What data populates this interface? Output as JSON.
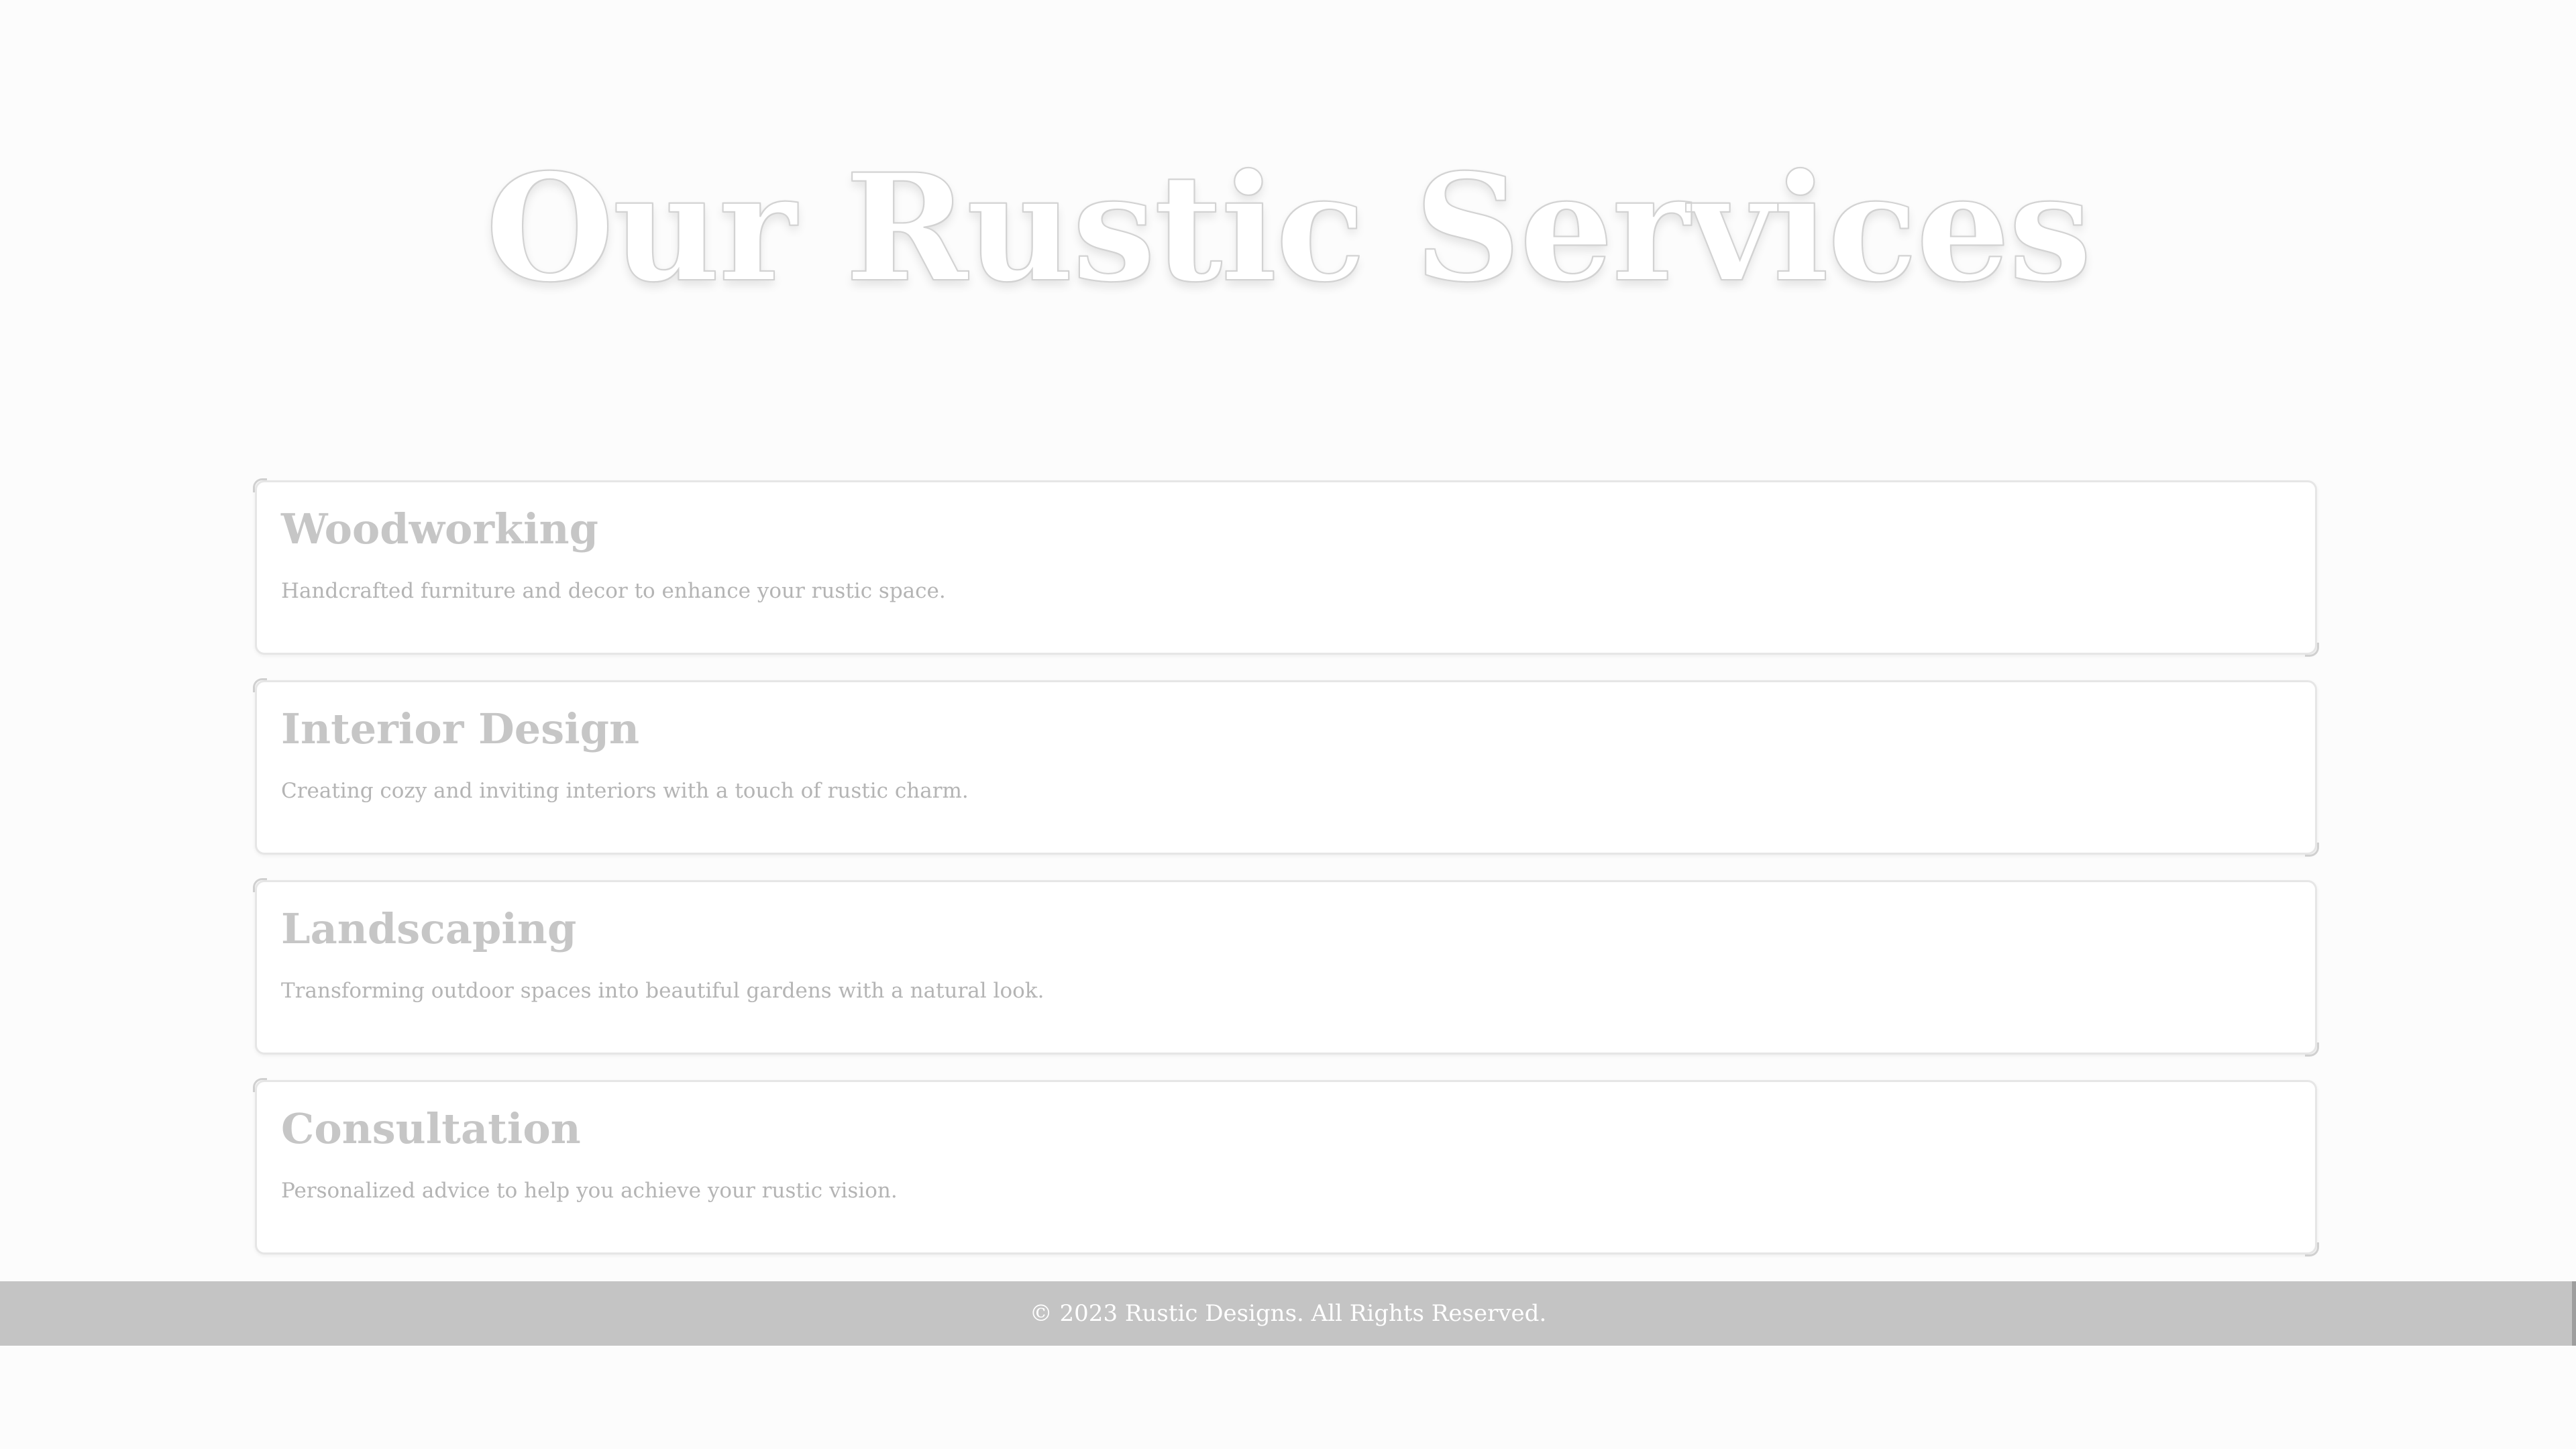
{
  "hero": {
    "title": "Our Rustic Services"
  },
  "services": [
    {
      "title": "Woodworking",
      "description": "Handcrafted furniture and decor to enhance your rustic space."
    },
    {
      "title": "Interior Design",
      "description": "Creating cozy and inviting interiors with a touch of rustic charm."
    },
    {
      "title": "Landscaping",
      "description": "Transforming outdoor spaces into beautiful gardens with a natural look."
    },
    {
      "title": "Consultation",
      "description": "Personalized advice to help you achieve your rustic vision."
    }
  ],
  "footer": {
    "text": "© 2023 Rustic Designs. All Rights Reserved."
  },
  "colors": {
    "background": "#fcfcfc",
    "card_background": "#ffffff",
    "heading_text": "#c6c6c6",
    "body_text": "#b4b4b4",
    "footer_background": "#c4c4c4",
    "footer_text": "#ffffff"
  }
}
